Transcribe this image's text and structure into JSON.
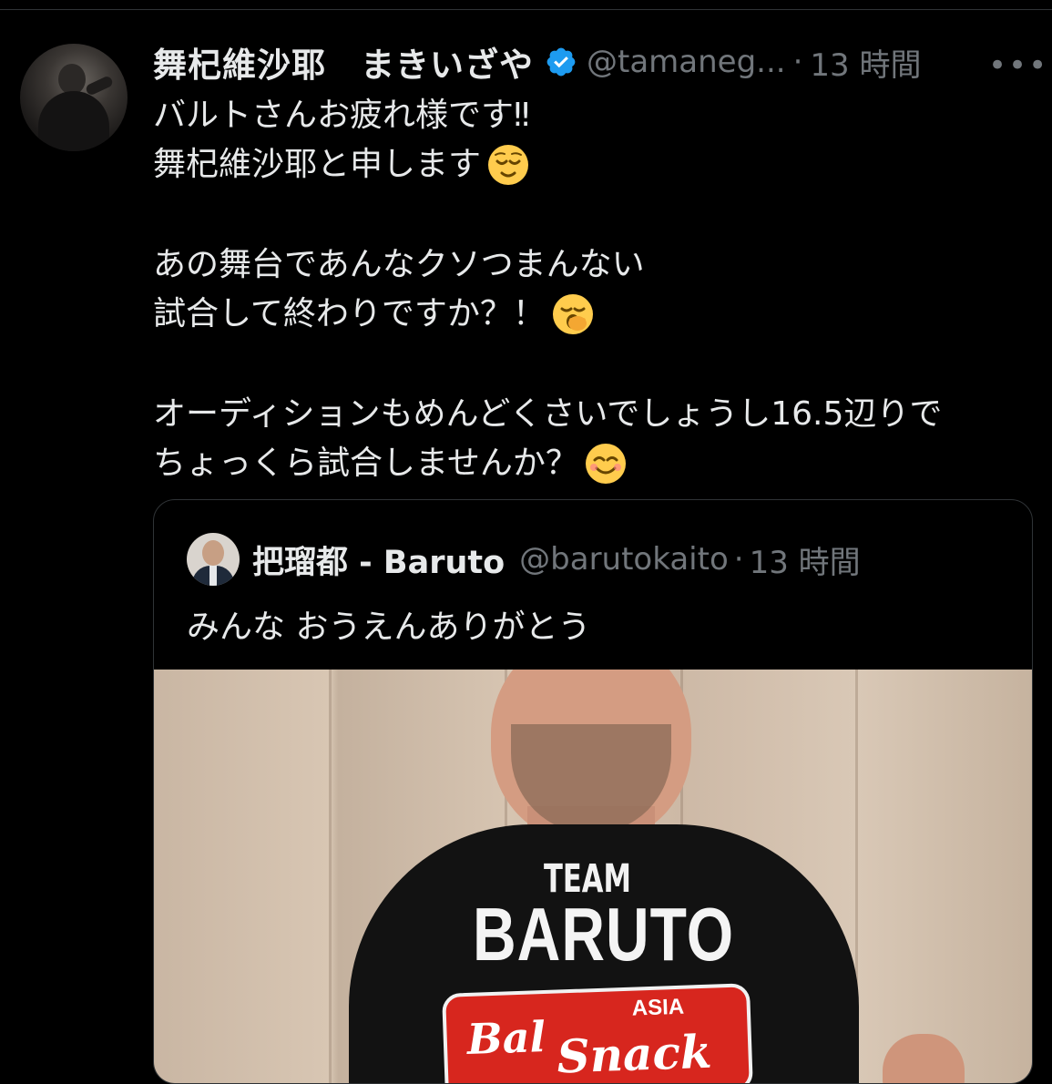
{
  "tweet": {
    "author_name": "舞杞維沙耶　まきいざや",
    "handle": "@tamaneg...",
    "separator": "·",
    "time": "13 時間",
    "more": "•••",
    "text_lines": [
      "バルトさんお疲れ様です‼︎",
      "舞杞維沙耶と申します",
      "",
      "あの舞台であんなクソつまんない",
      "試合して終わりですか？！",
      "",
      "オーディションもめんどくさいでしょうし16.5辺りで",
      "ちょっくら試合しませんか？"
    ],
    "emojis": [
      "relieved-face",
      "yawning-face",
      "smiling-face"
    ]
  },
  "quote": {
    "author_name": "把瑠都 - Baruto",
    "handle": "@barutokaito",
    "separator": "·",
    "time": "13 時間",
    "text": "みんな おうえんありがとう",
    "photo": {
      "shirt_line1": "TEAM",
      "shirt_line2": "BARUTO",
      "logo_word1": "Bal",
      "logo_word2": "Snack",
      "logo_small": "ASIA"
    }
  },
  "colors": {
    "background": "#000000",
    "text": "#e7e9ea",
    "secondary": "#71767b",
    "verified": "#1d9bf0",
    "border": "#2f3336"
  }
}
